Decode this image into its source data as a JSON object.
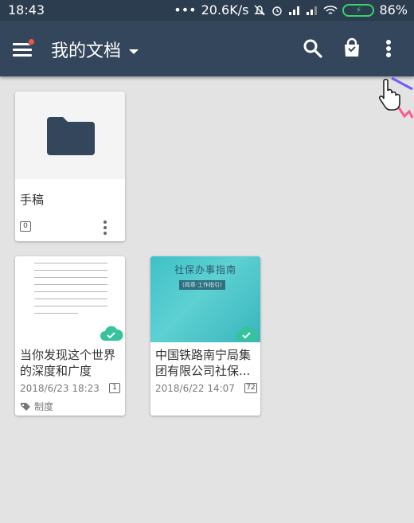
{
  "status": {
    "time": "18:43",
    "dots": "•••",
    "speed": "20.6K/s",
    "battery": "86%"
  },
  "toolbar": {
    "title": "我的文档",
    "icons": [
      "menu-icon",
      "search-icon",
      "bag-icon",
      "more-vert-icon"
    ]
  },
  "cards": [
    {
      "type": "folder",
      "title": "手稿",
      "count": "0"
    },
    {
      "type": "note",
      "title": "当你发现这个世界的深度和广度",
      "date": "2018/6/23 18:23",
      "count": "1",
      "tag": "制度"
    },
    {
      "type": "note",
      "title": "中国铁路南宁局集团有限公司社保...",
      "date": "2018/6/22 14:07",
      "count": "72",
      "thumb_title": "社保办事指南",
      "thumb_subtitle": "(简章·工作指引)"
    }
  ],
  "colors": {
    "toolbar": "#34465b",
    "statusbar": "#2c3d50",
    "folder": "#34465b",
    "cloud": "#35c29c",
    "background": "#e3e3e3"
  }
}
